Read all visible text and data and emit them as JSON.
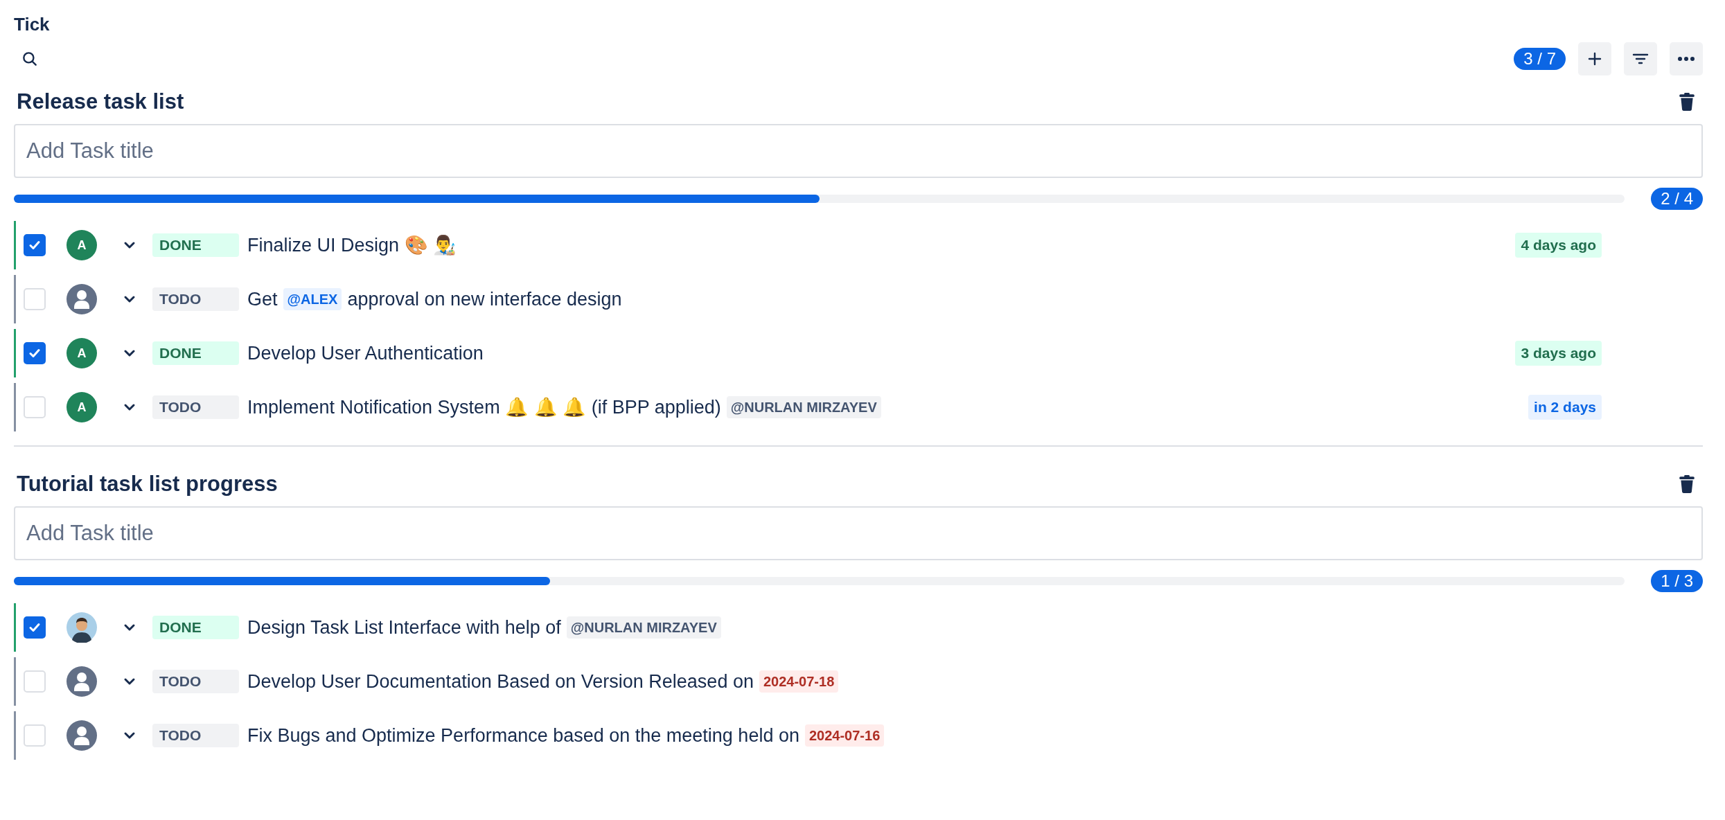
{
  "app": {
    "title": "Tick"
  },
  "toolbar": {
    "count": "3 / 7"
  },
  "lists": [
    {
      "title": "Release task list",
      "placeholder": "Add Task title",
      "progress": {
        "level": 0.5,
        "count": "2 / 4"
      },
      "tasks": [
        {
          "checked": true,
          "avatar": {
            "kind": "initial",
            "letter": "A"
          },
          "status": "DONE",
          "parts": [
            {
              "kind": "text",
              "text": "Finalize UI Design 🎨 👨‍🎨"
            }
          ],
          "due": {
            "kind": "past",
            "text": "4 days ago"
          }
        },
        {
          "checked": false,
          "avatar": {
            "kind": "default"
          },
          "status": "TODO",
          "parts": [
            {
              "kind": "text",
              "text": "Get"
            },
            {
              "kind": "mention_self",
              "text": "@ALEX"
            },
            {
              "kind": "text",
              "text": "approval on new interface design"
            }
          ]
        },
        {
          "checked": true,
          "avatar": {
            "kind": "initial",
            "letter": "A"
          },
          "status": "DONE",
          "parts": [
            {
              "kind": "text",
              "text": "Develop User Authentication"
            }
          ],
          "due": {
            "kind": "past",
            "text": "3 days ago"
          }
        },
        {
          "checked": false,
          "avatar": {
            "kind": "initial",
            "letter": "A"
          },
          "status": "TODO",
          "parts": [
            {
              "kind": "text",
              "text": "Implement Notification System 🔔 🔔 🔔 (if BPP applied)"
            },
            {
              "kind": "mention",
              "text": "@NURLAN MIRZAYEV"
            }
          ],
          "due": {
            "kind": "upcoming",
            "text": "in 2 days"
          }
        }
      ]
    },
    {
      "title": "Tutorial task list progress",
      "placeholder": "Add Task title",
      "progress": {
        "level": 0.333,
        "count": "1 / 3"
      },
      "tasks": [
        {
          "checked": true,
          "avatar": {
            "kind": "illustration"
          },
          "status": "DONE",
          "parts": [
            {
              "kind": "text",
              "text": "Design Task List Interface with help of"
            },
            {
              "kind": "mention",
              "text": "@NURLAN MIRZAYEV"
            }
          ]
        },
        {
          "checked": false,
          "avatar": {
            "kind": "default"
          },
          "status": "TODO",
          "parts": [
            {
              "kind": "text",
              "text": "Develop User Documentation Based on Version Released on"
            },
            {
              "kind": "date",
              "text": "2024-07-18"
            }
          ]
        },
        {
          "checked": false,
          "avatar": {
            "kind": "default"
          },
          "status": "TODO",
          "parts": [
            {
              "kind": "text",
              "text": "Fix Bugs and Optimize Performance based on the meeting held on"
            },
            {
              "kind": "date",
              "text": "2024-07-16"
            }
          ]
        }
      ]
    }
  ]
}
